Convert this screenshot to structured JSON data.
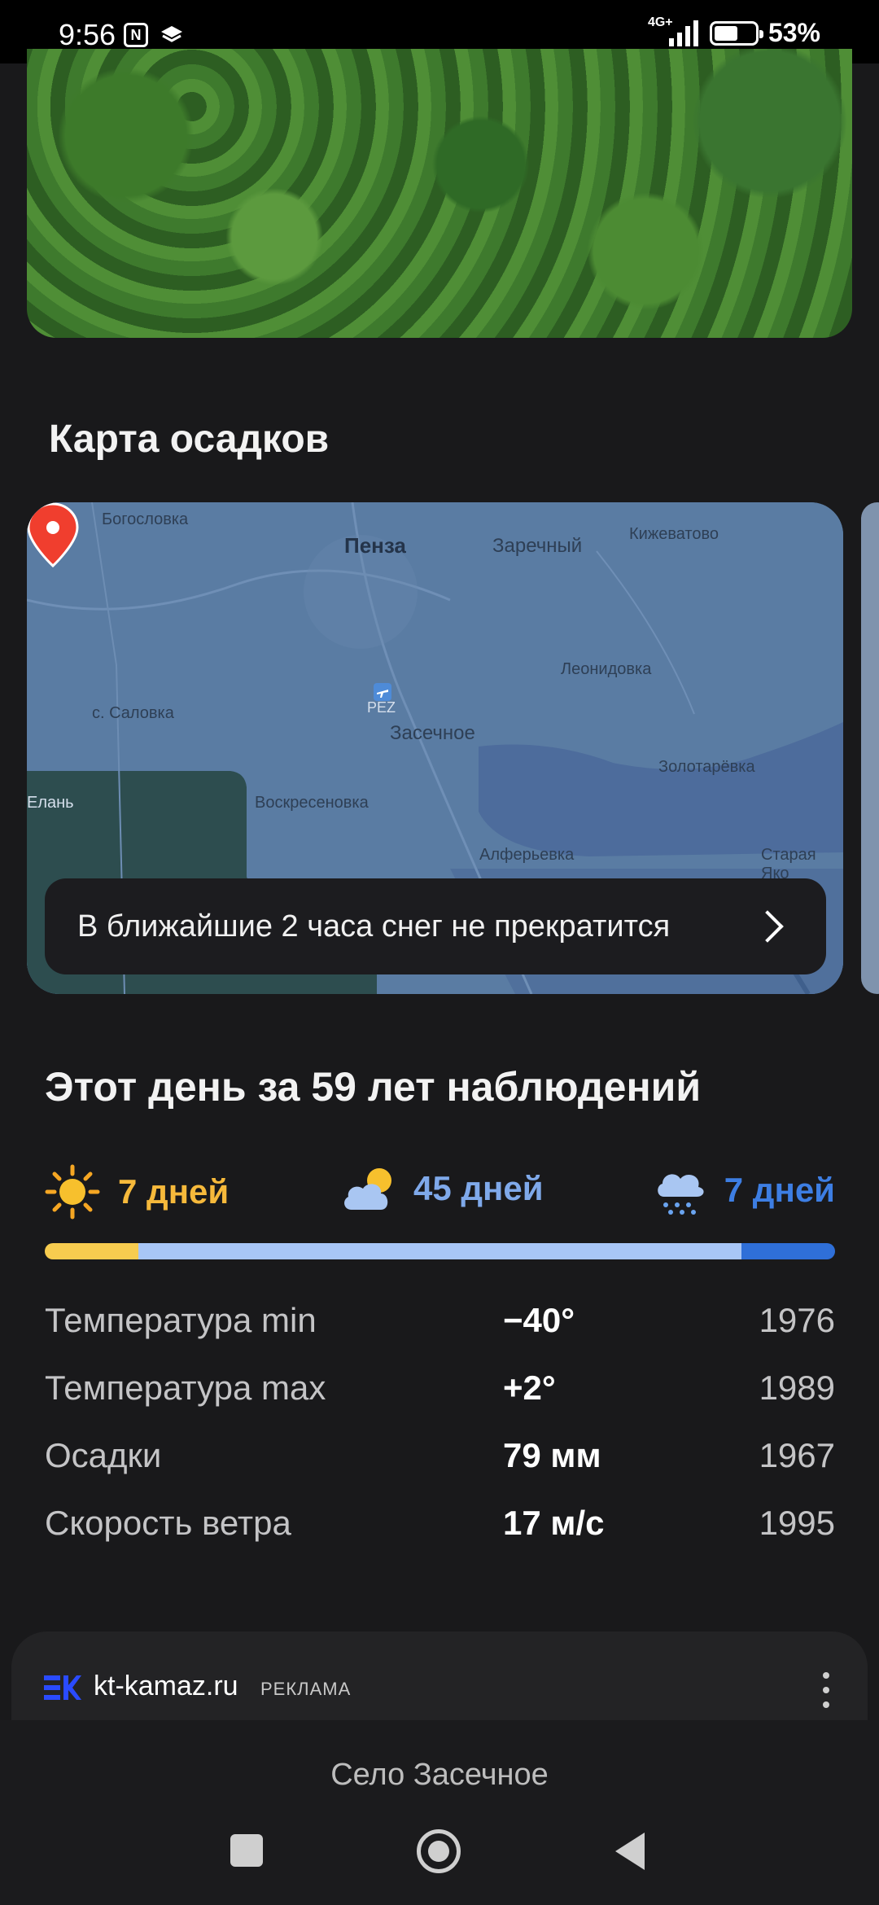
{
  "status_bar": {
    "time": "9:56",
    "network": "4G+",
    "battery": "53%",
    "icons": [
      "nfc-icon",
      "layers-icon",
      "signal-icon",
      "battery-icon"
    ]
  },
  "map_section": {
    "title": "Карта осадков",
    "labels": {
      "bogoslovka": "Богословка",
      "penza": "Пенза",
      "zarechny": "Заречный",
      "kizhevatovo": "Кижеватово",
      "pez": "PEZ",
      "zasechnoe": "Засечное",
      "leonidovka": "Леонидовка",
      "salovka": "с. Саловка",
      "zolotarevka": "Золотарёвка",
      "elan": "Елань",
      "voskresenovka": "Воскресеновка",
      "alferyevka": "Алферьевка",
      "staraya": "Старая Яко"
    },
    "banner_text": "В ближайшие 2 часа снег не прекратится",
    "icons": [
      "location-pin-icon",
      "airport-icon",
      "chevron-right-icon"
    ]
  },
  "history": {
    "title": "Этот день за 59 лет наблюдений",
    "sunny": {
      "label": "7 дней",
      "days": 7,
      "icon": "sun-icon",
      "color": "#f6b93b"
    },
    "cloudy": {
      "label": "45 дней",
      "days": 45,
      "icon": "cloud-sun-icon",
      "color": "#7fa9ea"
    },
    "snowy": {
      "label": "7 дней",
      "days": 7,
      "icon": "snow-cloud-icon",
      "color": "#3d7ee3"
    },
    "records": [
      {
        "label": "Температура min",
        "value": "−40°",
        "year": "1976"
      },
      {
        "label": "Температура max",
        "value": "+2°",
        "year": "1989"
      },
      {
        "label": "Осадки",
        "value": "79 мм",
        "year": "1967"
      },
      {
        "label": "Скорость ветра",
        "value": "17 м/с",
        "year": "1995"
      }
    ]
  },
  "ad": {
    "domain": "kt-kamaz.ru",
    "tag": "РЕКЛАМА",
    "logo_color": "#2a4bff"
  },
  "bottom": {
    "location": "Село Засечное"
  }
}
